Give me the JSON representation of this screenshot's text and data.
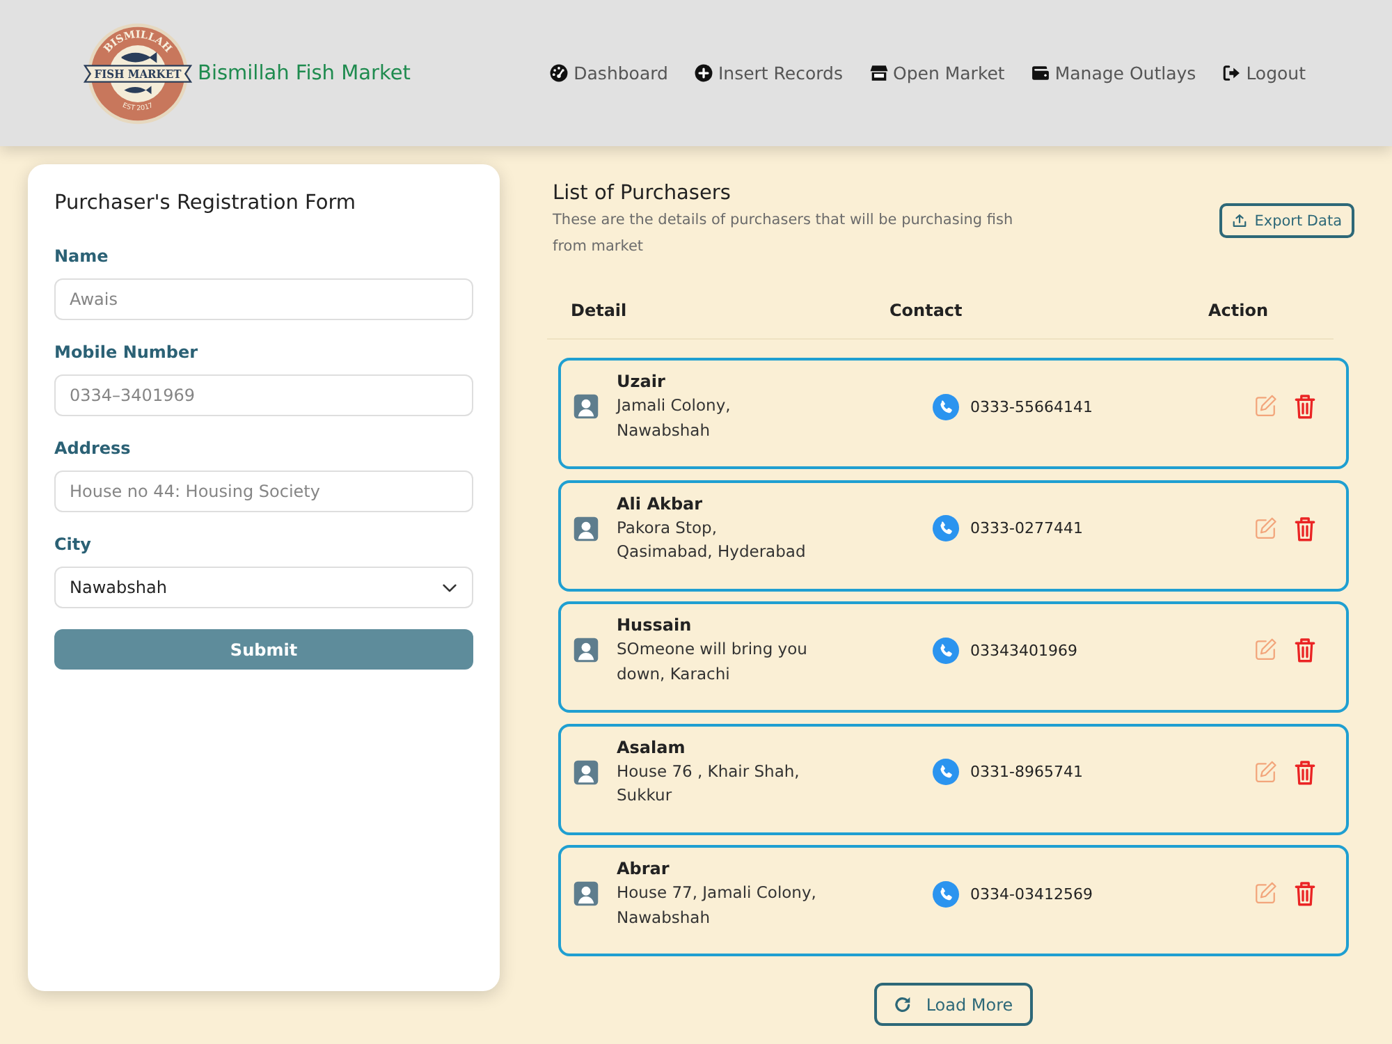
{
  "header": {
    "logo": {
      "top_text": "BISMILLAH",
      "banner_text": "FISH MARKET",
      "bottom_text": "EST 2017"
    },
    "brand": "Bismillah Fish Market",
    "nav": [
      {
        "label": "Dashboard"
      },
      {
        "label": "Insert Records"
      },
      {
        "label": "Open Market"
      },
      {
        "label": "Manage Outlays"
      },
      {
        "label": "Logout"
      }
    ]
  },
  "form": {
    "title": "Purchaser's Registration Form",
    "fields": [
      {
        "label": "Name",
        "kind": "text",
        "placeholder": "Awais"
      },
      {
        "label": "Mobile Number",
        "kind": "text",
        "placeholder": "0334–3401969"
      },
      {
        "label": "Address",
        "kind": "text",
        "placeholder": "House no 44: Housing Society"
      },
      {
        "label": "City",
        "kind": "select",
        "value": "Nawabshah"
      }
    ],
    "submit": "Submit"
  },
  "list": {
    "title": "List of Purchasers",
    "subtitle": "These are the details of purchasers that will be purchasing fish from market",
    "export_button": "Export Data",
    "columns": [
      "Detail",
      "Contact",
      "Action"
    ],
    "rows": [
      {
        "name": "Uzair",
        "address": "Jamali Colony, Nawabshah",
        "phone": "0333-55664141"
      },
      {
        "name": "Ali Akbar",
        "address": "Pakora Stop, Qasimabad, Hyderabad",
        "phone": "0333-0277441"
      },
      {
        "name": "Hussain",
        "address": "SOmeone will bring you down, Karachi",
        "phone": "03343401969"
      },
      {
        "name": "Asalam",
        "address": "House 76 , Khair Shah, Sukkur",
        "phone": "0331-8965741"
      },
      {
        "name": "Abrar",
        "address": "House 77, Jamali Colony, Nawabshah",
        "phone": "0334-03412569"
      }
    ],
    "load_more": "Load More"
  }
}
